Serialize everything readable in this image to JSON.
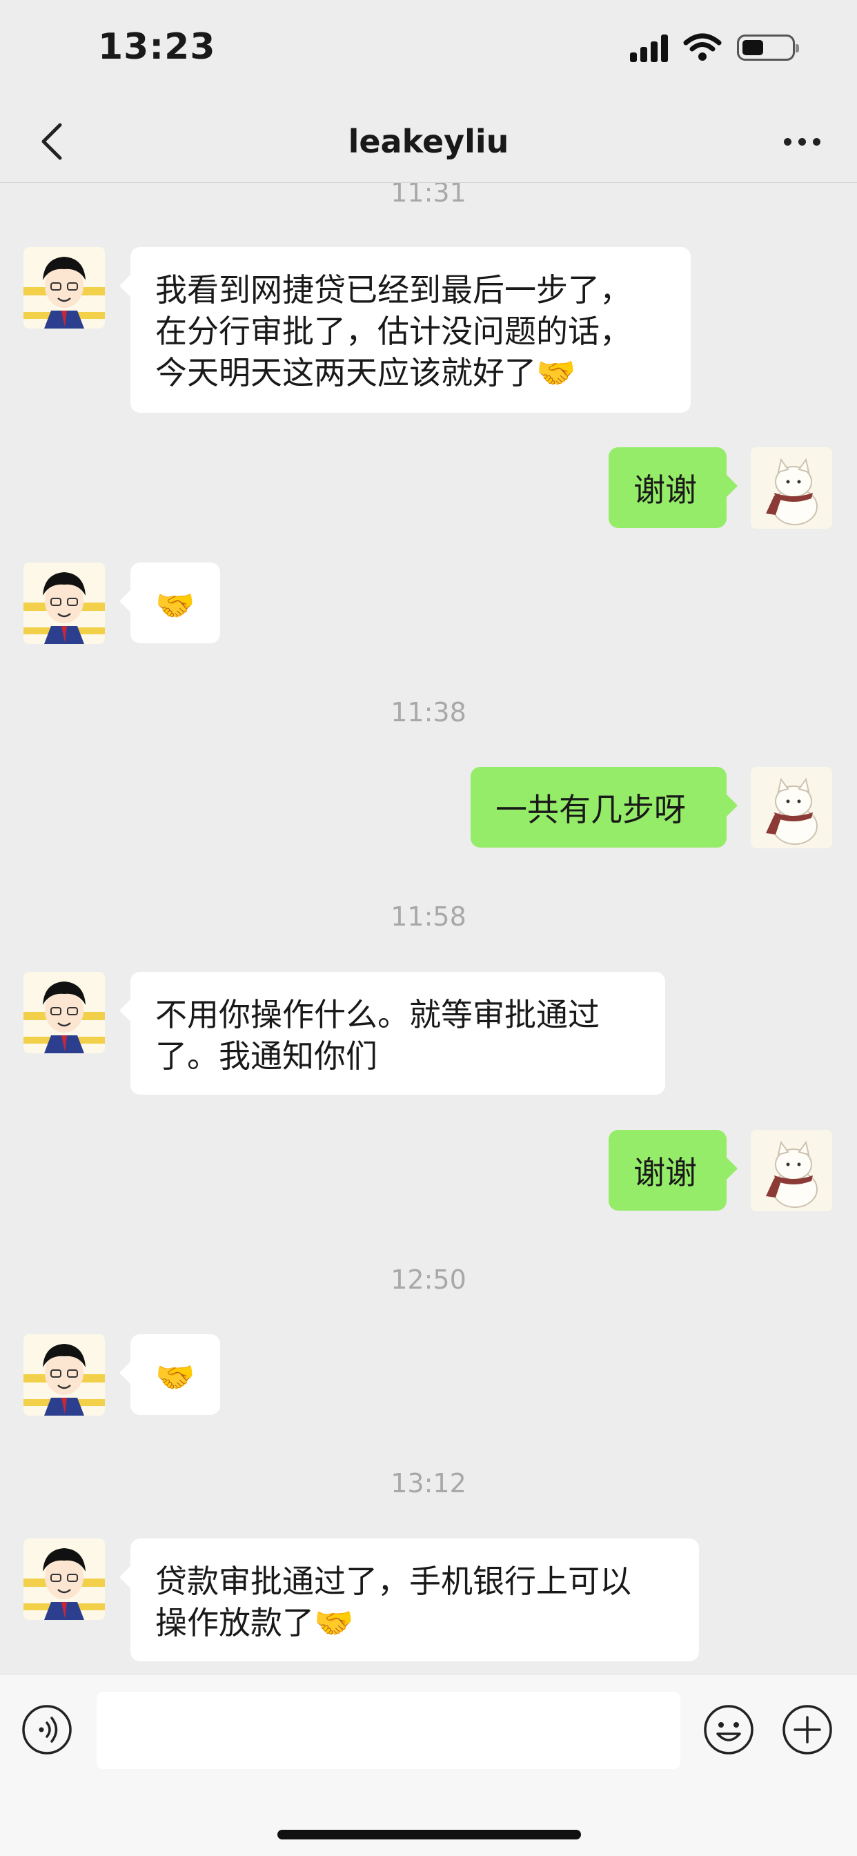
{
  "status_bar": {
    "time": "13:23"
  },
  "nav": {
    "title": "leakeyliu"
  },
  "messages": {
    "t1": "11:31",
    "m1": "我看到网捷贷已经到最后一步了，\n在分行审批了，估计没问题的话，\n今天明天这两天应该就好了🤝",
    "m2": "谢谢",
    "m3": "🤝",
    "t2": "11:38",
    "m4": "一共有几步呀",
    "t3": "11:58",
    "m5": "不用你操作什么。就等审批通过\n了。我通知你们",
    "m6": "谢谢",
    "t4": "12:50",
    "m7": "🤝",
    "t5": "13:12",
    "m8": "贷款审批通过了，手机银行上可以\n操作放款了🤝"
  },
  "input": {
    "placeholder": ""
  },
  "colors": {
    "outgoing_bubble": "#95ec69",
    "incoming_bubble": "#ffffff",
    "background": "#ededed"
  },
  "icons": [
    "chevron-left-icon",
    "more-dots-icon",
    "voice-icon",
    "emoji-icon",
    "plus-icon"
  ]
}
